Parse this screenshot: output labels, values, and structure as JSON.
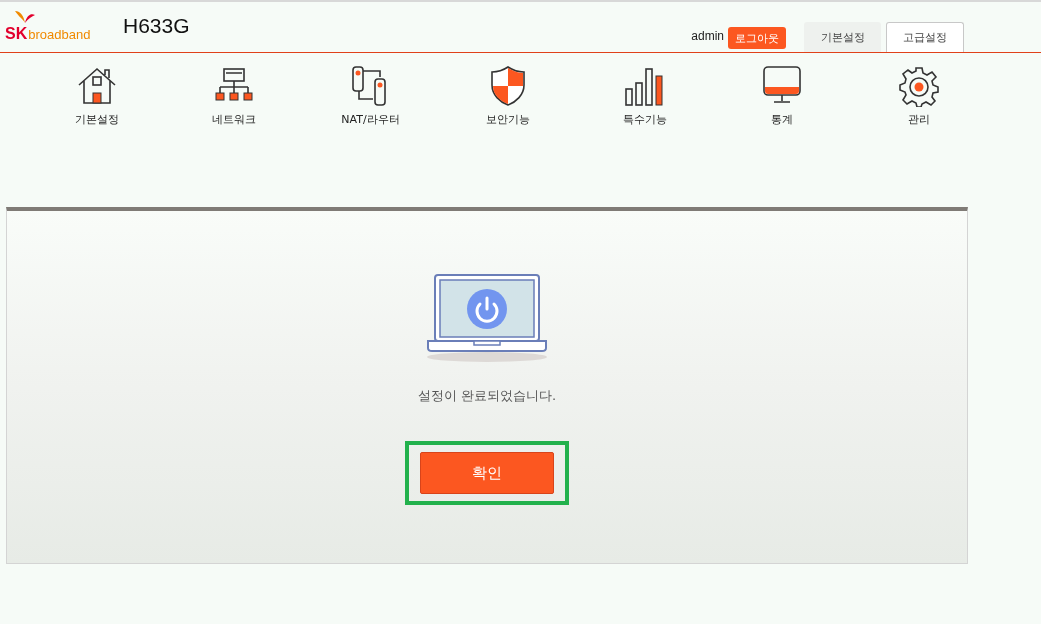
{
  "header": {
    "logo": {
      "brand": "SK",
      "sub": "broadband"
    },
    "model": "H633G",
    "user": "admin",
    "logout": "로그아웃",
    "tabs": [
      {
        "label": "기본설정",
        "selected": false
      },
      {
        "label": "고급설정",
        "selected": true
      }
    ]
  },
  "nav": [
    {
      "kind": "home",
      "label": "기본설정"
    },
    {
      "kind": "network",
      "label": "네트워크"
    },
    {
      "kind": "router",
      "label": "NAT/라우터"
    },
    {
      "kind": "shield",
      "label": "보안기능"
    },
    {
      "kind": "bars",
      "label": "특수기능"
    },
    {
      "kind": "monitor",
      "label": "통계"
    },
    {
      "kind": "gear",
      "label": "관리"
    }
  ],
  "panel": {
    "message": "설정이 완료되었습니다.",
    "confirm": "확인",
    "confirm_highlighted": true
  }
}
